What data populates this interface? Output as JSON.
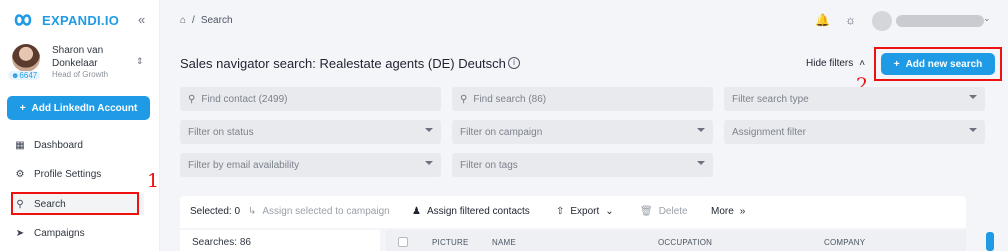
{
  "brand": {
    "name": "EXPANDI.IO",
    "accent": "#1f9be6"
  },
  "sidebar": {
    "collapse_icon": "double-chevron-left-icon",
    "profile": {
      "name": "Sharon van Donkelaar",
      "role": "Head of Growth",
      "count": "6647"
    },
    "add_account_label": "Add LinkedIn Account",
    "items": [
      {
        "label": "Dashboard",
        "icon": "dashboard-icon"
      },
      {
        "label": "Profile Settings",
        "icon": "gear-icon"
      },
      {
        "label": "Search",
        "icon": "search-icon",
        "active": true
      },
      {
        "label": "Campaigns",
        "icon": "campaigns-icon"
      }
    ]
  },
  "breadcrumb": {
    "home_icon": "home-icon",
    "separator": "/",
    "current": "Search"
  },
  "header": {
    "title": "Sales navigator search: Realestate agents (DE) Deutsch",
    "hide_filters_label": "Hide filters",
    "add_search_label": "Add new search"
  },
  "filters": {
    "find_contact": "Find contact (2499)",
    "find_search": "Find search (86)",
    "search_type": "Filter search type",
    "status": "Filter on status",
    "campaign": "Filter on campaign",
    "assignment": "Assignment filter",
    "email": "Filter by email availability",
    "tags": "Filter on tags"
  },
  "toolbar": {
    "selected": "Selected: 0",
    "assign_selected": "Assign selected to campaign",
    "assign_filtered": "Assign filtered contacts",
    "export": "Export",
    "delete": "Delete",
    "more": "More"
  },
  "searches_label": "Searches:",
  "searches_count": "86",
  "table": {
    "columns": [
      "PICTURE",
      "NAME",
      "OCCUPATION",
      "COMPANY"
    ]
  },
  "annotations": {
    "one": "1",
    "two": "2",
    "color": "#ee1111"
  }
}
